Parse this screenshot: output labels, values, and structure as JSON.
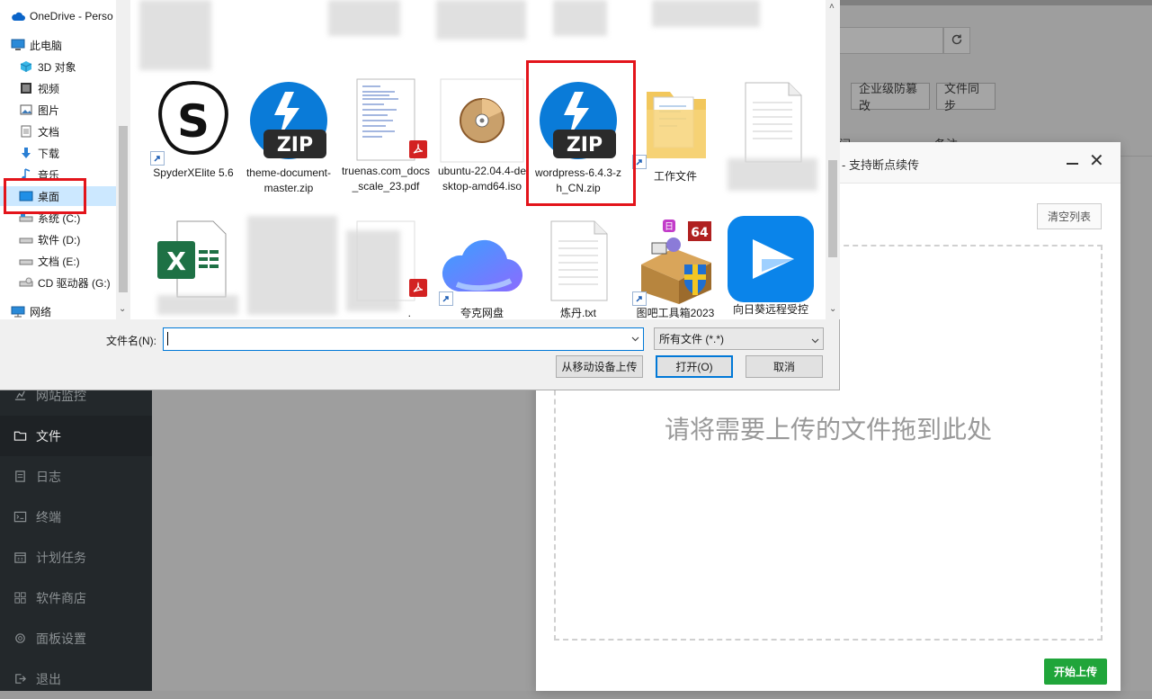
{
  "bt_panel": {
    "menu": [
      {
        "label": "网站监控",
        "icon": "monitor-icon"
      },
      {
        "label": "文件",
        "icon": "folder-icon",
        "active": true
      },
      {
        "label": "日志",
        "icon": "log-icon"
      },
      {
        "label": "终端",
        "icon": "terminal-icon"
      },
      {
        "label": "计划任务",
        "icon": "calendar-icon"
      },
      {
        "label": "软件商店",
        "icon": "grid-icon"
      },
      {
        "label": "面板设置",
        "icon": "gear-icon"
      },
      {
        "label": "退出",
        "icon": "logout-icon"
      }
    ],
    "toolbar": {
      "tamper_label": "企业级防篡改",
      "sync_label": "文件同步"
    },
    "table": {
      "col_time": "间",
      "col_note": "备注"
    }
  },
  "upload_modal": {
    "title": "- 支持断点续传",
    "clear_label": "清空列表",
    "drop_text": "请将需要上传的文件拖到此处",
    "start_label": "开始上传"
  },
  "file_dialog": {
    "nav": [
      {
        "label": "OneDrive - Perso",
        "icon": "cloud-icon"
      },
      {
        "label": "此电脑",
        "icon": "computer-icon"
      },
      {
        "label": "3D 对象",
        "icon": "cube-icon"
      },
      {
        "label": "视频",
        "icon": "video-icon"
      },
      {
        "label": "图片",
        "icon": "picture-icon"
      },
      {
        "label": "文档",
        "icon": "document-icon"
      },
      {
        "label": "下载",
        "icon": "download-icon"
      },
      {
        "label": "音乐",
        "icon": "music-icon"
      },
      {
        "label": "桌面",
        "icon": "desktop-icon",
        "selected": true
      },
      {
        "label": "系统 (C:)",
        "icon": "drive-icon"
      },
      {
        "label": "软件 (D:)",
        "icon": "drive-icon"
      },
      {
        "label": "文档 (E:)",
        "icon": "drive-icon"
      },
      {
        "label": "CD 驱动器 (G:)",
        "icon": "cd-drive-icon"
      },
      {
        "label": "网络",
        "icon": "network-icon"
      }
    ],
    "files_row1": [
      {
        "label": "SpyderXElite 5.6",
        "icon": "spyder-icon"
      },
      {
        "label": "theme-document-master.zip",
        "icon": "zip-icon"
      },
      {
        "label": "truenas.com_docs_scale_23.pdf",
        "icon": "pdf-icon"
      },
      {
        "label": "ubuntu-22.04.4-desktop-amd64.iso",
        "icon": "disc-icon"
      },
      {
        "label": "wordpress-6.4.3-zh_CN.zip",
        "icon": "zip-icon"
      },
      {
        "label": "工作文件",
        "icon": "folder-icon"
      },
      {
        "label": "",
        "icon": "text-file-icon"
      }
    ],
    "files_row2": [
      {
        "label": "",
        "icon": "excel-icon"
      },
      {
        "label": ".",
        "icon": "pdf-icon"
      },
      {
        "label": "夸克网盘",
        "icon": "quark-cloud-icon"
      },
      {
        "label": "炼丹.txt",
        "icon": "text-file-icon"
      },
      {
        "label": "图吧工具箱2023",
        "icon": "toolbox-icon"
      },
      {
        "label": "向日葵远程受控",
        "icon": "sunlogin-icon"
      }
    ],
    "filename_label": "文件名(N):",
    "filename_value": "",
    "filter_value": "所有文件 (*.*)",
    "mobile_upload_label": "从移动设备上传",
    "open_label": "打开(O)",
    "cancel_label": "取消"
  },
  "colors": {
    "highlight": "#e3141b",
    "accent": "#0078d7",
    "bt_green": "#20a53a",
    "zip_blue": "#0a7bd8"
  }
}
